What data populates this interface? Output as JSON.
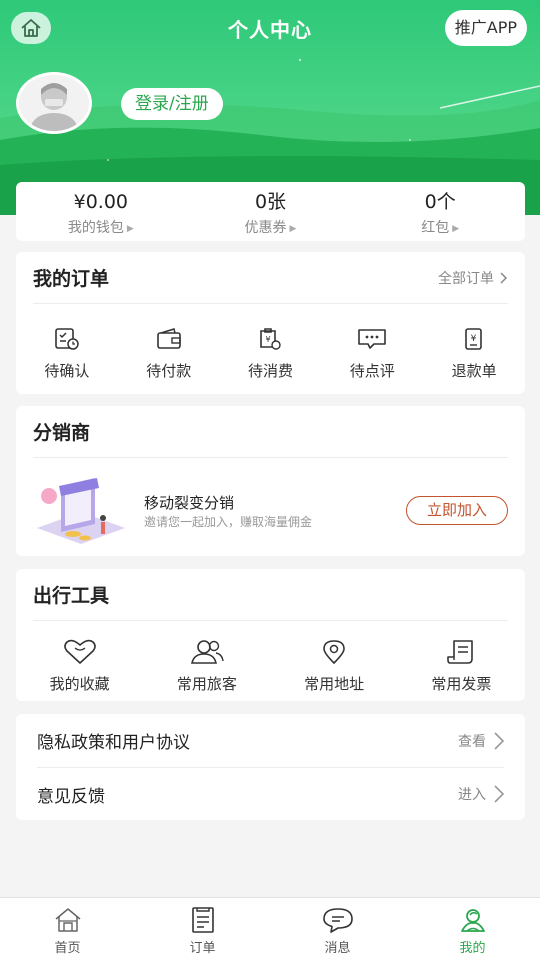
{
  "header": {
    "title": "个人中心",
    "promo_label": "推广APP",
    "login_label": "登录/注册"
  },
  "wallet": [
    {
      "value": "¥0.00",
      "label": "我的钱包"
    },
    {
      "value": "0张",
      "label": "优惠券"
    },
    {
      "value": "0个",
      "label": "红包"
    }
  ],
  "orders": {
    "title": "我的订单",
    "more_label": "全部订单",
    "items": [
      {
        "label": "待确认",
        "icon": "pending-confirm-icon"
      },
      {
        "label": "待付款",
        "icon": "wallet-icon"
      },
      {
        "label": "待消费",
        "icon": "ticket-icon"
      },
      {
        "label": "待点评",
        "icon": "comment-icon"
      },
      {
        "label": "退款单",
        "icon": "refund-icon"
      }
    ]
  },
  "distributor": {
    "title": "分销商",
    "name": "移动裂变分销",
    "desc": "邀请您一起加入，赚取海量佣金",
    "join_label": "立即加入"
  },
  "tools": {
    "title": "出行工具",
    "items": [
      {
        "label": "我的收藏",
        "icon": "heart-icon"
      },
      {
        "label": "常用旅客",
        "icon": "people-icon"
      },
      {
        "label": "常用地址",
        "icon": "location-icon"
      },
      {
        "label": "常用发票",
        "icon": "invoice-icon"
      }
    ]
  },
  "links": [
    {
      "label": "隐私政策和用户协议",
      "action": "查看"
    },
    {
      "label": "意见反馈",
      "action": "进入"
    }
  ],
  "tabbar": [
    {
      "label": "首页",
      "icon": "home-icon",
      "active": false
    },
    {
      "label": "订单",
      "icon": "order-icon",
      "active": false
    },
    {
      "label": "消息",
      "icon": "message-icon",
      "active": false
    },
    {
      "label": "我的",
      "icon": "profile-icon",
      "active": true
    }
  ],
  "colors": {
    "brand_green": "#2ec879",
    "active_tab": "#2aa74e",
    "join_button": "#c2542e"
  }
}
